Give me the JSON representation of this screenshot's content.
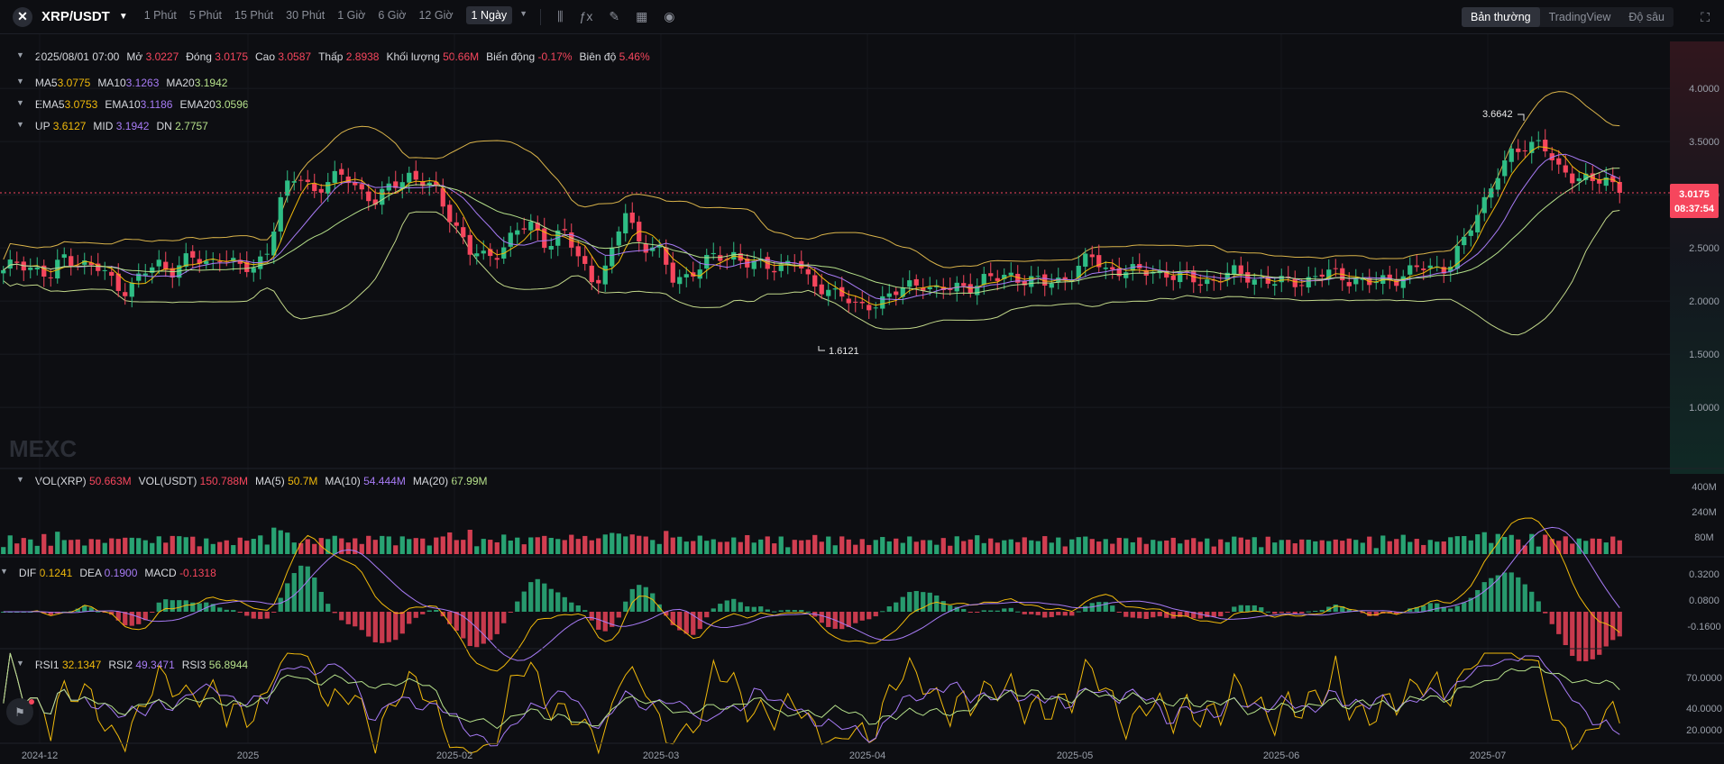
{
  "header": {
    "pair": "XRP/USDT",
    "timeframes": [
      "1 Phút",
      "5 Phút",
      "15 Phút",
      "30 Phút",
      "1 Giờ",
      "6 Giờ",
      "12 Giờ",
      "1 Ngày"
    ],
    "active_timeframe": "1 Ngày",
    "view_modes": [
      "Bản thường",
      "TradingView",
      "Độ sâu"
    ],
    "active_view": "Bản thường"
  },
  "ohlc": {
    "date": "2025/08/01 07:00",
    "open_label": "Mở",
    "open": "3.0227",
    "close_label": "Đóng",
    "close": "3.0175",
    "high_label": "Cao",
    "high": "3.0587",
    "low_label": "Thấp",
    "low": "2.8938",
    "vol_label": "Khối lượng",
    "vol": "50.66M",
    "change_label": "Biến động",
    "change": "-0.17%",
    "amp_label": "Biên độ",
    "amp": "5.46%"
  },
  "ma": {
    "ma5_label": "MA5",
    "ma5": "3.0775",
    "ma10_label": "MA10",
    "ma10": "3.1263",
    "ma20_label": "MA20",
    "ma20": "3.1942"
  },
  "ema": {
    "ema5_label": "EMA5",
    "ema5": "3.0753",
    "ema10_label": "EMA10",
    "ema10": "3.1186",
    "ema20_label": "EMA20",
    "ema20": "3.0596"
  },
  "boll": {
    "up_label": "UP",
    "up": "3.6127",
    "mid_label": "MID",
    "mid": "3.1942",
    "dn_label": "DN",
    "dn": "2.7757"
  },
  "vol": {
    "vxrp_label": "VOL(XRP)",
    "vxrp": "50.663M",
    "vusdt_label": "VOL(USDT)",
    "vusdt": "150.788M",
    "ma5_label": "MA(5)",
    "ma5": "50.7M",
    "ma10_label": "MA(10)",
    "ma10": "54.444M",
    "ma20_label": "MA(20)",
    "ma20": "67.99M"
  },
  "macd": {
    "dif_label": "DIF",
    "dif": "0.1241",
    "dea_label": "DEA",
    "dea": "0.1900",
    "macd_label": "MACD",
    "macd": "-0.1318"
  },
  "rsi": {
    "rsi1_label": "RSI1",
    "rsi1": "32.1347",
    "rsi2_label": "RSI2",
    "rsi2": "49.3471",
    "rsi3_label": "RSI3",
    "rsi3": "56.8944"
  },
  "watermark": "MEXC",
  "chart_data": {
    "type": "candlestick",
    "price_axis": [
      "4.0000",
      "3.5000",
      "3.0000",
      "2.5000",
      "2.0000",
      "1.5000",
      "1.0000"
    ],
    "last_price": "3.0175",
    "countdown": "08:37:54",
    "max_label": "3.6642",
    "min_label": "1.6121",
    "volume_axis": [
      "400M",
      "240M",
      "80M"
    ],
    "macd_axis": [
      "0.3200",
      "0.0800",
      "-0.1600"
    ],
    "rsi_axis": [
      "70.0000",
      "40.0000",
      "20.0000"
    ],
    "x_axis": [
      "2024-12",
      "2025",
      "2025-02",
      "2025-03",
      "2025-04",
      "2025-05",
      "2025-06",
      "2025-07"
    ],
    "close_series": [
      2.25,
      2.4,
      2.3,
      2.2,
      2.45,
      2.35,
      2.3,
      2.2,
      2.1,
      2.25,
      2.35,
      2.3,
      2.4,
      2.35,
      2.45,
      2.3,
      2.3,
      2.5,
      3.0,
      3.2,
      3.05,
      3.1,
      3.2,
      3.05,
      2.9,
      3.1,
      3.2,
      3.1,
      3.0,
      2.75,
      2.45,
      2.4,
      2.5,
      2.65,
      2.7,
      2.55,
      2.65,
      2.4,
      2.2,
      2.35,
      2.85,
      2.55,
      2.5,
      2.2,
      2.25,
      2.35,
      2.4,
      2.45,
      2.35,
      2.3,
      2.35,
      2.4,
      2.1,
      2.15,
      2.05,
      1.9,
      2.0,
      2.05,
      2.1,
      2.2,
      2.1,
      2.1,
      2.15,
      2.2,
      2.2,
      2.25,
      2.2,
      2.15,
      2.2,
      2.3,
      2.4,
      2.3,
      2.3,
      2.25,
      2.3,
      2.25,
      2.2,
      2.2,
      2.2,
      2.25,
      2.25,
      2.2,
      2.15,
      2.2,
      2.2,
      2.25,
      2.25,
      2.2,
      2.15,
      2.2,
      2.25,
      2.3,
      2.3,
      2.35,
      2.55,
      2.85,
      3.2,
      3.35,
      3.45,
      3.55,
      3.2,
      3.15,
      3.2,
      3.1,
      3.0175
    ],
    "colors": {
      "up": "#2ebd85",
      "down": "#f6465d",
      "bg": "#0d0e12",
      "ma5": "#f0b90b",
      "ma10": "#a77bf5",
      "ma20": "#b5e08a",
      "price_line": "#f6465d"
    }
  }
}
